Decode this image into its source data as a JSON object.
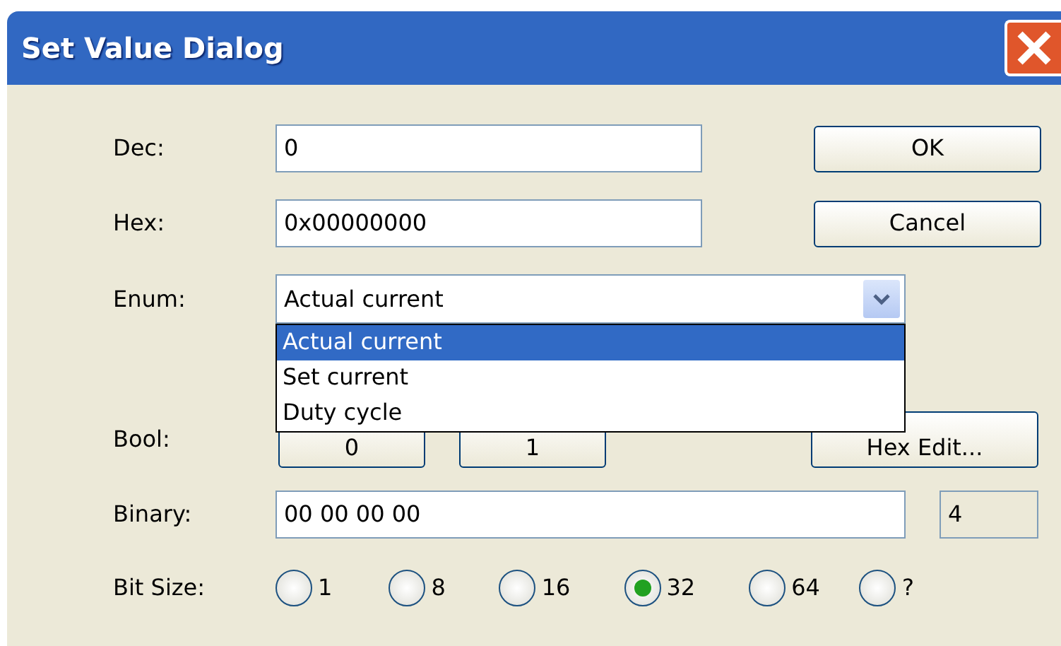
{
  "window": {
    "title": "Set Value Dialog"
  },
  "fields": [
    {
      "label": "Dec:",
      "value": "0"
    },
    {
      "label": "Hex:",
      "value": "0x00000000"
    }
  ],
  "buttons": [
    "OK",
    "Cancel"
  ],
  "enum": {
    "label": "Enum:",
    "value": "Actual current",
    "expanded": true,
    "options": [
      {
        "label": "Actual current",
        "selected": true
      },
      {
        "label": "Set current",
        "selected": false
      },
      {
        "label": "Duty cycle",
        "selected": false
      }
    ]
  },
  "bool": {
    "label": "Bool:",
    "buttons": [
      "0",
      "1"
    ]
  },
  "hex_edit_button": "Hex Edit...",
  "binary": {
    "label": "Binary:",
    "value": "00 00 00 00",
    "size": "4"
  },
  "bit_size": {
    "label": "Bit Size:",
    "options": [
      {
        "label": "1",
        "selected": false
      },
      {
        "label": "8",
        "selected": false
      },
      {
        "label": "16",
        "selected": false
      },
      {
        "label": "32",
        "selected": true
      },
      {
        "label": "64",
        "selected": false
      },
      {
        "label": "?",
        "selected": false
      }
    ]
  }
}
